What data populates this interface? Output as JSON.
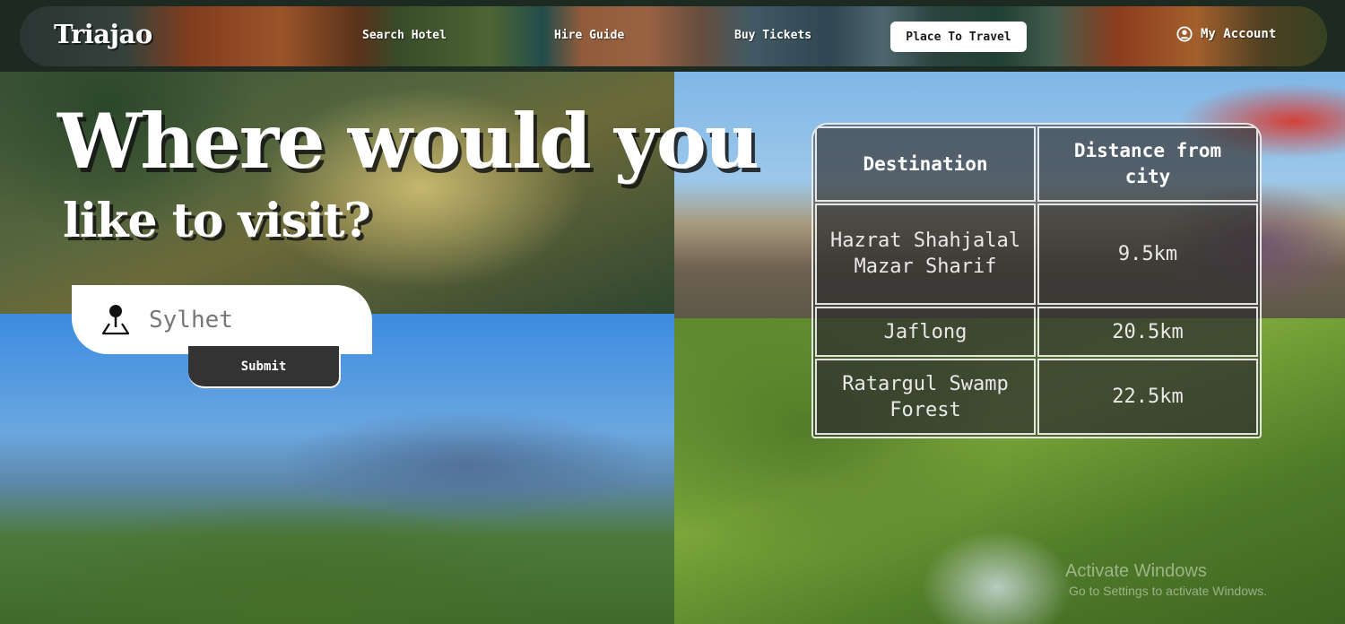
{
  "navbar": {
    "brand": "Triajao",
    "links": [
      {
        "label": "Search Hotel"
      },
      {
        "label": "Hire Guide"
      },
      {
        "label": "Buy Tickets"
      }
    ],
    "active_link": "Place To Travel",
    "account_label": "My Account",
    "account_icon": "user-circle-icon"
  },
  "hero": {
    "headline_line1": "Where would you",
    "headline_line2": "like to visit?"
  },
  "search": {
    "icon": "map-pin-icon",
    "value": "Sylhet",
    "submit_label": "Submit"
  },
  "table": {
    "headers": [
      "Destination",
      "Distance from city"
    ],
    "rows": [
      {
        "destination": "Hazrat Shahjalal Mazar Sharif",
        "distance": "9.5km"
      },
      {
        "destination": "Jaflong",
        "distance": "20.5km"
      },
      {
        "destination": "Ratargul Swamp Forest",
        "distance": "22.5km"
      }
    ]
  },
  "watermark": {
    "title": "Activate Windows",
    "subtitle": "Go to Settings to activate Windows."
  }
}
